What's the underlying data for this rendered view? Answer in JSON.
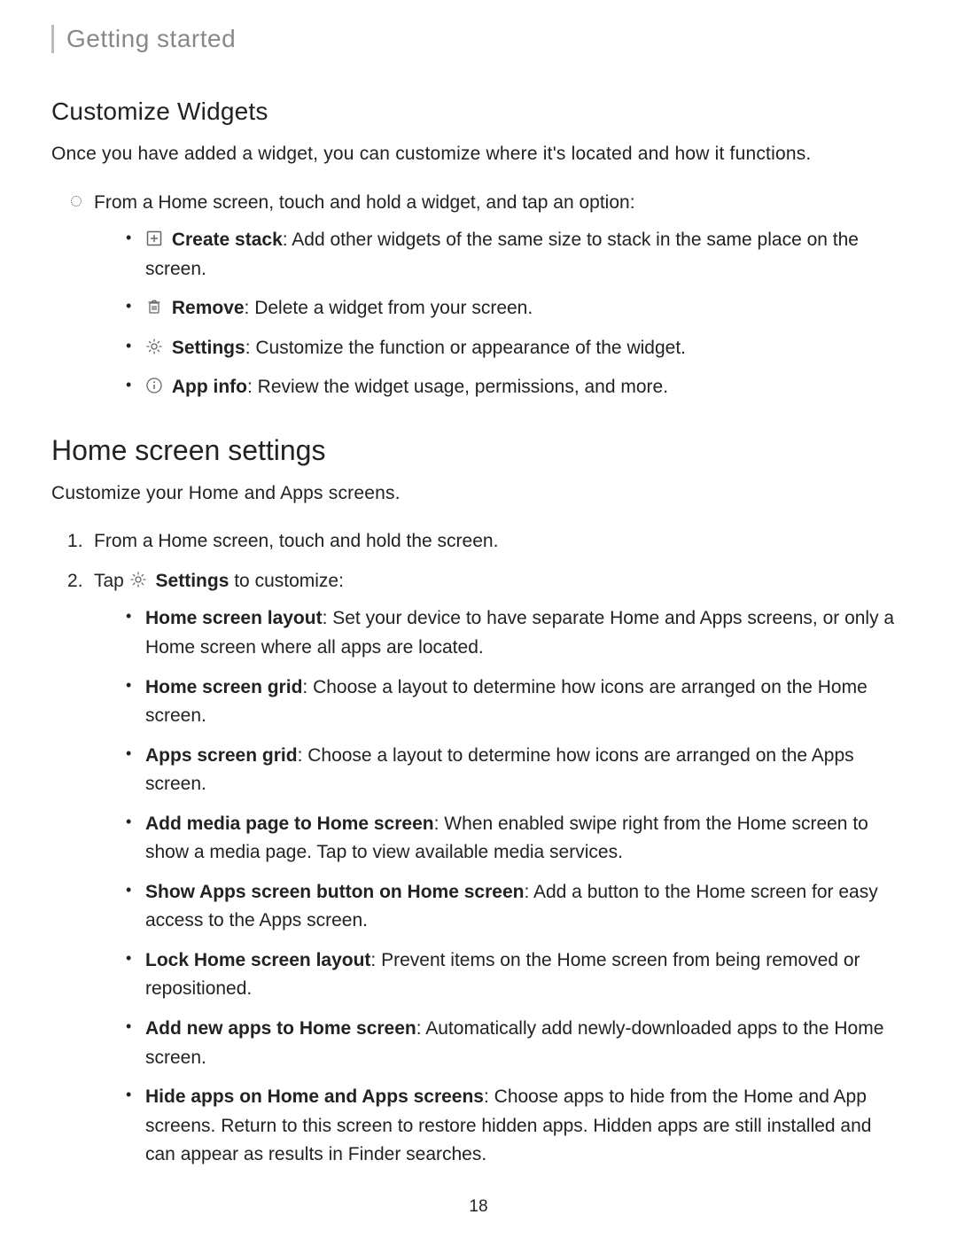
{
  "header": "Getting started",
  "section1": {
    "title": "Customize Widgets",
    "intro": "Once you have added a widget, you can customize where it's located and how it functions.",
    "lead": "From a Home screen, touch and hold a widget, and tap an option:",
    "items": [
      {
        "label": "Create stack",
        "desc": ": Add other widgets of the same size to stack in the same place on the screen."
      },
      {
        "label": "Remove",
        "desc": ": Delete a widget from your screen."
      },
      {
        "label": "Settings",
        "desc": ": Customize the function or appearance of the widget."
      },
      {
        "label": "App info",
        "desc": ": Review the widget usage, permissions, and more."
      }
    ]
  },
  "section2": {
    "title": "Home screen settings",
    "intro": "Customize your Home and Apps screens.",
    "step1": "From a Home screen, touch and hold the screen.",
    "step2_pre": "Tap ",
    "step2_label": "Settings",
    "step2_post": " to customize:",
    "items": [
      {
        "label": "Home screen layout",
        "desc": ": Set your device to have separate Home and Apps screens, or only a Home screen where all apps are located."
      },
      {
        "label": "Home screen grid",
        "desc": ": Choose a layout to determine how icons are arranged on the Home screen."
      },
      {
        "label": "Apps screen grid",
        "desc": ": Choose a layout to determine how icons are arranged on the Apps screen."
      },
      {
        "label": "Add media page to Home screen",
        "desc": ": When enabled swipe right from the Home screen to show a media page. Tap to view available media services."
      },
      {
        "label": "Show Apps screen button on Home screen",
        "desc": ": Add a button to the Home screen for easy access to the Apps screen."
      },
      {
        "label": "Lock Home screen layout",
        "desc": ": Prevent items on the Home screen from being removed or repositioned."
      },
      {
        "label": "Add new apps to Home screen",
        "desc": ": Automatically add newly-downloaded apps to the Home screen."
      },
      {
        "label": "Hide apps on Home and Apps screens",
        "desc": ": Choose apps to hide from the Home and App screens. Return to this screen to restore hidden apps. Hidden apps are still installed and can appear as results in Finder searches."
      }
    ]
  },
  "page_number": "18"
}
